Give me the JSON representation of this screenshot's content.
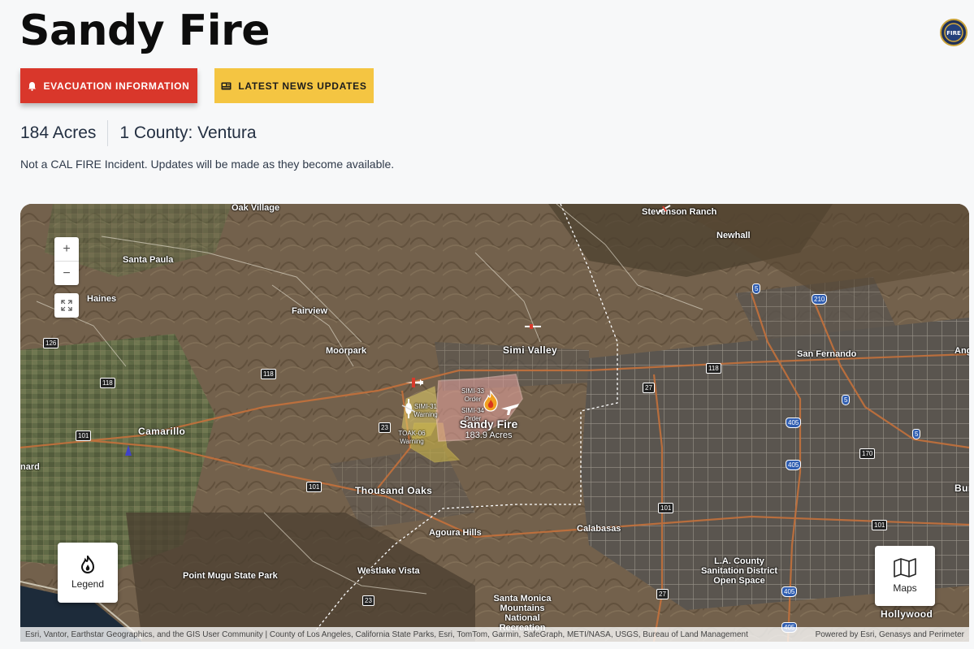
{
  "header": {
    "title": "Sandy Fire",
    "logo_text": "FIRE"
  },
  "buttons": {
    "evacuation_label": "EVACUATION INFORMATION",
    "news_label": "LATEST NEWS UPDATES"
  },
  "stats": {
    "acres": "184 Acres",
    "county": "1 County: Ventura"
  },
  "note": "Not a CAL FIRE Incident. Updates will be made as they become available.",
  "colors": {
    "evac_red": "#d9372b",
    "news_yellow": "#f4c542",
    "fire_perimeter": "#e8a5a0",
    "warning_zone": "#c9b44a"
  },
  "map": {
    "zoom_in": "+",
    "zoom_out": "−",
    "legend_label": "Legend",
    "maps_label": "Maps",
    "fire": {
      "name": "Sandy Fire",
      "acres": "183.9 Acres"
    },
    "zones": {
      "simi33": "SIMI-33 Order",
      "simi34": "SIMI-34 Order",
      "simi31": "SIMI-31 Warning",
      "toak06": "TOAK-06 Warning"
    },
    "places": {
      "oak_village": "Oak Village",
      "stevenson_ranch": "Stevenson Ranch",
      "newhall": "Newhall",
      "santa_paula": "Santa Paula",
      "haines": "Haines",
      "fairview": "Fairview",
      "moorpark": "Moorpark",
      "simi_valley": "Simi Valley",
      "san_fernando": "San Fernando",
      "camarillo": "Camarillo",
      "oxnard": "nard",
      "thousand_oaks": "Thousand Oaks",
      "agoura_hills": "Agoura Hills",
      "calabasas": "Calabasas",
      "westlake_vista": "Westlake Vista",
      "point_mugu": "Point Mugu State Park",
      "la_county": "L.A. County Sanitation District Open Space",
      "santa_monica": "Santa Monica Mountains National Recreation",
      "hollywood": "Hollywood",
      "angeles": "Ange",
      "burbank": "Bur"
    },
    "shields": {
      "r126": "126",
      "r118a": "118",
      "r118b": "118",
      "r118c": "118",
      "r23a": "23",
      "r23b": "23",
      "r101a": "101",
      "r101b": "101",
      "r101c": "101",
      "r101d": "101",
      "r27a": "27",
      "r27b": "27",
      "r5a": "5",
      "r5b": "5",
      "r5c": "5",
      "r210": "210",
      "r405a": "405",
      "r405b": "405",
      "r405c": "405",
      "r405d": "405",
      "r170": "170"
    },
    "attribution_left": "Esri, Vantor, Earthstar Geographics, and the GIS User Community | County of Los Angeles, California State Parks, Esri, TomTom, Garmin, SafeGraph, METI/NASA, USGS, Bureau of Land Management",
    "attribution_right": "Powered by Esri, Genasys and Perimeter"
  }
}
